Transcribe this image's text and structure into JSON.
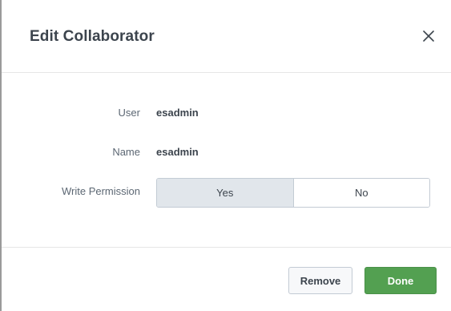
{
  "dialog": {
    "title": "Edit Collaborator",
    "close_icon": "close-icon"
  },
  "fields": {
    "user_label": "User",
    "user_value": "esadmin",
    "name_label": "Name",
    "name_value": "esadmin",
    "write_permission_label": "Write Permission",
    "write_permission_options": [
      "Yes",
      "No"
    ],
    "write_permission_selected": "Yes"
  },
  "footer": {
    "remove_label": "Remove",
    "done_label": "Done"
  },
  "colors": {
    "done_button": "#53a051",
    "selected_toggle": "#e1e6eb"
  }
}
